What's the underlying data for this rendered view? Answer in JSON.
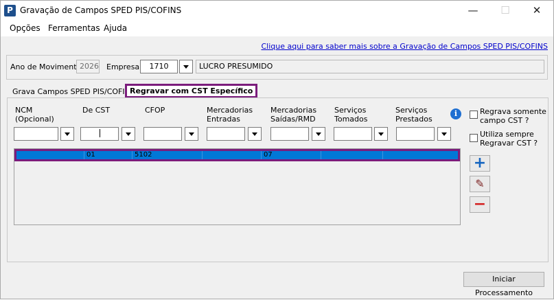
{
  "window": {
    "title": "Gravação de Campos SPED PIS/COFINS",
    "icon_letter": "P",
    "controls": {
      "minimize": "—",
      "maximize": "☐",
      "close": "✕"
    }
  },
  "menu": [
    "Opções",
    "Ferramentas",
    "Ajuda"
  ],
  "link_text": "Clique aqui para saber mais sobre a Gravação de Campos SPED PIS/COFINS",
  "header": {
    "ano_label": "Ano de Movimento:",
    "ano_value": "2026",
    "empresa_label": "Empresa:",
    "empresa_value": "1710",
    "empresa_name": "LUCRO PRESUMIDO"
  },
  "tabs": [
    {
      "label": "Grava Campos SPED PIS/COFINS",
      "active": false
    },
    {
      "label": "Regravar com CST Específico",
      "active": true
    }
  ],
  "filters": {
    "ncm": "NCM\n(Opcional)",
    "de_cst": "De CST",
    "cfop": "CFOP",
    "merc_entradas": "Mercadorias\nEntradas",
    "merc_saidas": "Mercadorias\nSaídas/RMD",
    "serv_tomados": "Serviços\nTomados",
    "serv_prestados": "Serviços\nPrestados"
  },
  "options": {
    "regrava_cst": "Regrava somente\ncampo CST ?",
    "utiliza_sempre": "Utiliza sempre\nRegravar CST ?"
  },
  "grid_row": {
    "cells": [
      "",
      "01",
      "5102",
      "",
      "07",
      "",
      ""
    ]
  },
  "buttons": {
    "add": "+",
    "edit": "✎",
    "remove": "−",
    "start": "Iniciar Processamento"
  },
  "colors": {
    "selection": "#0078d7",
    "highlight_border": "#7b1c7c",
    "link": "#0000cc"
  }
}
